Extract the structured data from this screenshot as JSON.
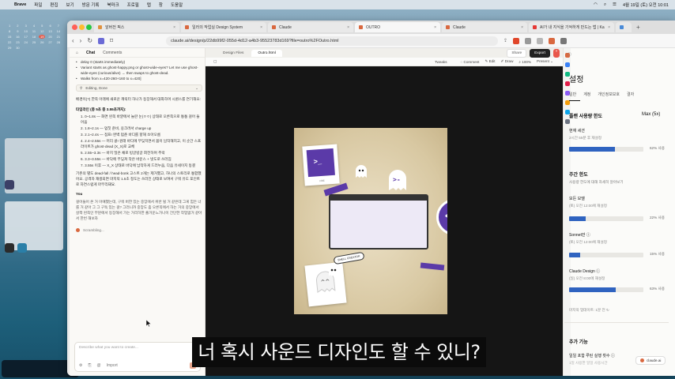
{
  "menubar": {
    "app": "Brave",
    "items": [
      "파일",
      "편집",
      "보기",
      "방문 기록",
      "북마크",
      "프로필",
      "탭",
      "창",
      "도움말"
    ],
    "clock": "4월 19일 (토) 오전 10:01"
  },
  "desktop": {
    "calendar_days": [
      "1",
      "2",
      "3",
      "4",
      "5",
      "6",
      "7",
      "8",
      "9",
      "10",
      "11",
      "12",
      "13",
      "14",
      "15",
      "16",
      "17",
      "18",
      "19",
      "20",
      "21",
      "22",
      "23",
      "24",
      "25",
      "26",
      "27",
      "28",
      "29",
      "30"
    ],
    "today": "19"
  },
  "browser": {
    "tabs": [
      {
        "label": "앞버전 픽스",
        "color": "#e0913d"
      },
      {
        "label": "일러의 작업실 Design System",
        "color": "#d9683f"
      },
      {
        "label": "Claude",
        "color": "#d9683f"
      },
      {
        "label": "OUTRO",
        "color": "#d9683f",
        "active": true
      },
      {
        "label": "Claude",
        "color": "#d9683f"
      },
      {
        "label": "AI가 내 지식을 기억하게 만드는 법 | Ka",
        "color": "#e53935"
      },
      {
        "label": "",
        "color": "#4a8bd8"
      }
    ],
    "url": "claude.ai/design/p/22db99f2-055d-4d12-a4b3-95523783d169?file=outro%2FOutro.html"
  },
  "chat": {
    "tabs": [
      "Chat",
      "Comments"
    ],
    "bullets": [
      "delay 0 (starts immediately)",
      "Variant starts as ghost-happy.png or ghost-wide-eyes? Let me use ghost-wide-eyes (curious/alive) → then swaps to ghost-dead.",
      "Walks from x=420-260+160 to x=420]"
    ],
    "editing": "Editing, Done",
    "intro": "배경이(?) 한쪽 아래에 새로운 캐릭터 하나가 등장해서 대화하며 시퀀스를 연기해요:",
    "timeline_title": "타임라인 (총 5초 중 3.55초까지):",
    "timeline": [
      "0~1.8s — 화면 왼쪽 바깥에서 놀란 눈(ㅇㅇ) 상태로 오른쪽으로 통통 걸어 들어옴",
      "1.8~2.1s — 멈칫 준비, 웅크려서 charge up",
      "2.1~2.4s — 점프! 완벽 멈춘 바디를 향해 쏘아오름",
      "2.4~2.55s — 머리 쿵! 원래 바디에 부딪치면서 몸이 납작해지고, 이 순간 스프라이트가 ghost-dead (X_X)로 교체",
      "2.55~3.3s — 바치 밀은 채로 빙글빙글 회전하며 추락",
      "3.3~3.55s — 바닥에 부딪쳐 작은 바운스 + 밧도로 쓰러짐",
      "3.55s 이후 — X_X 상태로 바닥에 납작하게 드러누움, 다음 유세이지 동결"
    ],
    "note": "기존의 별도 dead-fall / head-bonk 고스트 2개는 제거했고, 하나의 스토리로 통합했어요. 공격자 재생되면 마지막 1.5초 정도는 쓰러진 상태로 보여서 구워 유도 포인트로 자연스럽게 마무리돼요.",
    "you_label": "You",
    "you_message": "걸어들어 온 거 아예했는데, 구워 버한 있는 중앙에서 위반 될 거 같은데 그게 힘든 너를 거 같아 그 그 구독 있는 걸? 그러니까 중앙도 좀 오른쪽에서 하는 거의 중앙에서 살짝 왼쪽인 부분에서 등장해서 가는 거리하한 즐거운느가나이 간단한 작업없거 같아서 한번 해보자",
    "status": "Scrambling...",
    "input_placeholder": "Describe what you want to create...",
    "import_label": "Import"
  },
  "design": {
    "file_tabs": [
      "Design Files",
      "Outro.html"
    ],
    "share_label": "Share",
    "export_label": "Export",
    "tweaks_label": "Tweaks",
    "comment_label": "Comment",
    "edit_label": "Edit",
    "draw_label": "Draw",
    "zoom": "100%",
    "present_label": "Present",
    "stage_labels": {
      "card_top": "VIBE",
      "badge": "SHELL CREATOR"
    }
  },
  "subtitle": "너 혹시 사운드 디자인도 할 수 있니?",
  "settings": {
    "title": "설정",
    "tabs": [
      "일반",
      "계정",
      "개인정보보호",
      "결자"
    ],
    "usage_title": "플랜 사용량 한도",
    "plan": "Max (5x)",
    "current_session": "현재 세션",
    "current_reset": "2시간 55분 후 재설정",
    "current_pct": 62,
    "current_pct_label": "62% 사용",
    "weekly_title": "주간 한도",
    "weekly_link": "사용량 한도에 대해 자세히 알아보기",
    "all_models": "모든 모델",
    "all_reset": "(토) 오전 12:00에 재설정",
    "all_pct": 22,
    "all_pct_label": "22% 사용",
    "sonnet": "Sonnet만",
    "sonnet_reset": "(토) 오전 12:00에 재설정",
    "sonnet_pct": 15,
    "sonnet_pct_label": "15% 사용",
    "design": "Claude Design",
    "design_reset": "(일) 오전 8:00에 재설정",
    "design_pct": 63,
    "design_pct_label": "63% 사용",
    "last_update": "마지막 업데이트: 1분 전",
    "extra_title": "추가 기능",
    "extra_item": "일일 포함 루틴 실행 횟수",
    "extra_sub": "1일 사용한 일일 사용시간",
    "badge": "claude.ai"
  },
  "colors": {
    "accent": "#d9683f",
    "usage_bar": "#2f63c0",
    "ghost_purple": "#5b3aa8"
  }
}
